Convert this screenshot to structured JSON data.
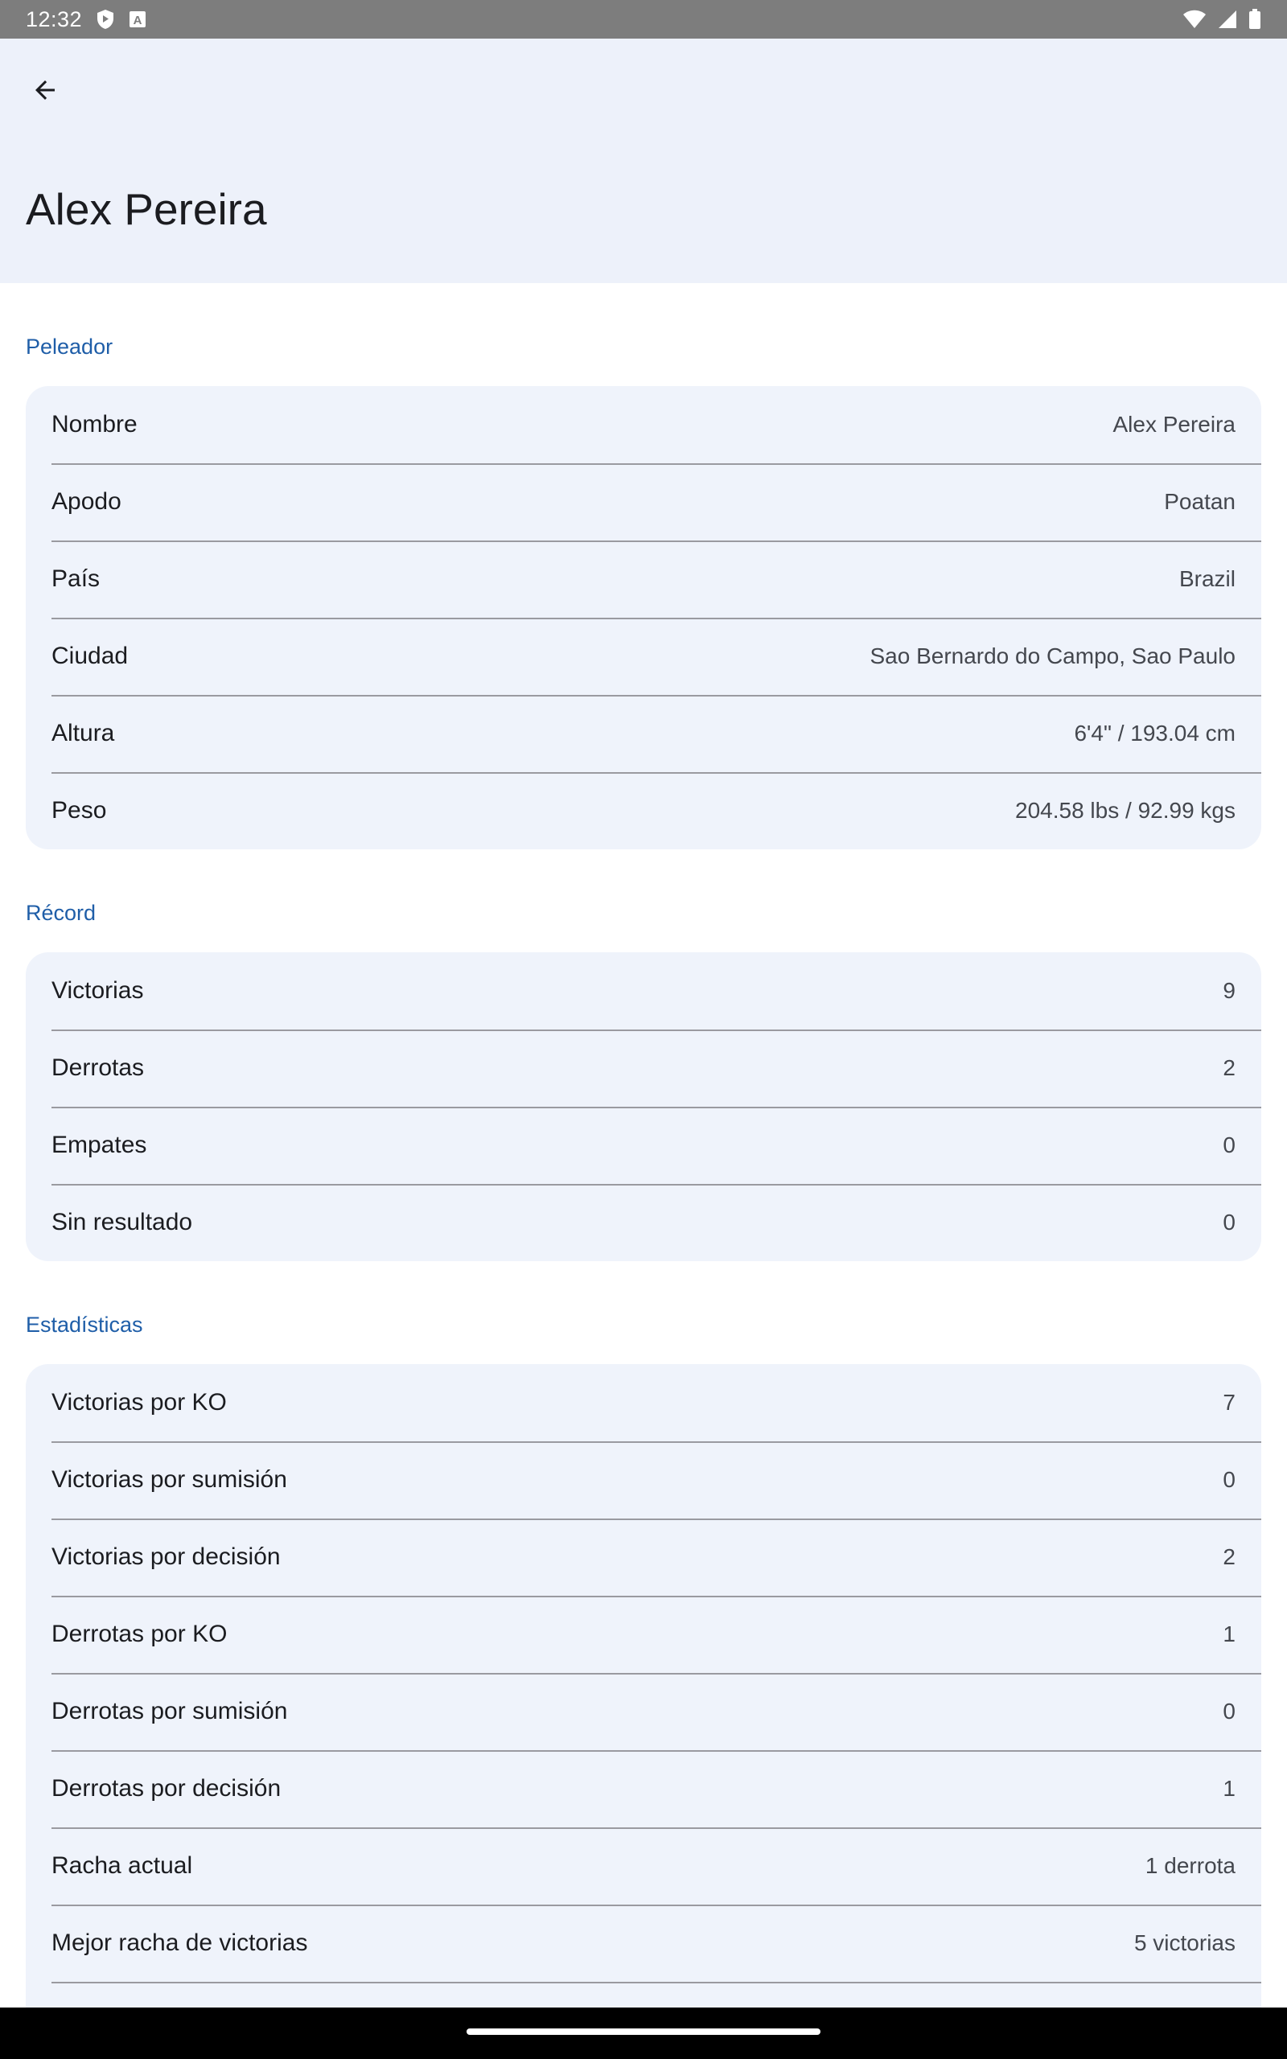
{
  "status_bar": {
    "time": "12:32",
    "icons_left": [
      "shield-icon",
      "font-a-icon"
    ],
    "icons_right": [
      "wifi-icon",
      "signal-icon",
      "battery-icon"
    ]
  },
  "app_bar": {
    "back_icon": "arrow-left-icon",
    "title": "Alex Pereira"
  },
  "sections": {
    "fighter": {
      "header": "Peleador",
      "rows": [
        {
          "label": "Nombre",
          "value": "Alex Pereira"
        },
        {
          "label": "Apodo",
          "value": "Poatan"
        },
        {
          "label": "País",
          "value": "Brazil"
        },
        {
          "label": "Ciudad",
          "value": "Sao Bernardo do Campo, Sao Paulo"
        },
        {
          "label": "Altura",
          "value": "6'4\" / 193.04 cm"
        },
        {
          "label": "Peso",
          "value": "204.58 lbs / 92.99 kgs"
        }
      ]
    },
    "record": {
      "header": "Récord",
      "rows": [
        {
          "label": "Victorias",
          "value": "9"
        },
        {
          "label": "Derrotas",
          "value": "2"
        },
        {
          "label": "Empates",
          "value": "0"
        },
        {
          "label": "Sin resultado",
          "value": "0"
        }
      ]
    },
    "stats": {
      "header": "Estadísticas",
      "rows": [
        {
          "label": "Victorias por KO",
          "value": "7"
        },
        {
          "label": "Victorias por sumisión",
          "value": "0"
        },
        {
          "label": "Victorias por decisión",
          "value": "2"
        },
        {
          "label": "Derrotas por KO",
          "value": "1"
        },
        {
          "label": "Derrotas por sumisión",
          "value": "0"
        },
        {
          "label": "Derrotas por decisión",
          "value": "1"
        },
        {
          "label": "Racha actual",
          "value": "1 derrota"
        },
        {
          "label": "Mejor racha de victorias",
          "value": "5 victorias"
        }
      ]
    }
  },
  "colors": {
    "app_bar_bg": "#edf1fa",
    "card_bg": "#eff3fb",
    "section_header": "#1f5ea8",
    "status_bar_bg": "#7d7d7d"
  }
}
